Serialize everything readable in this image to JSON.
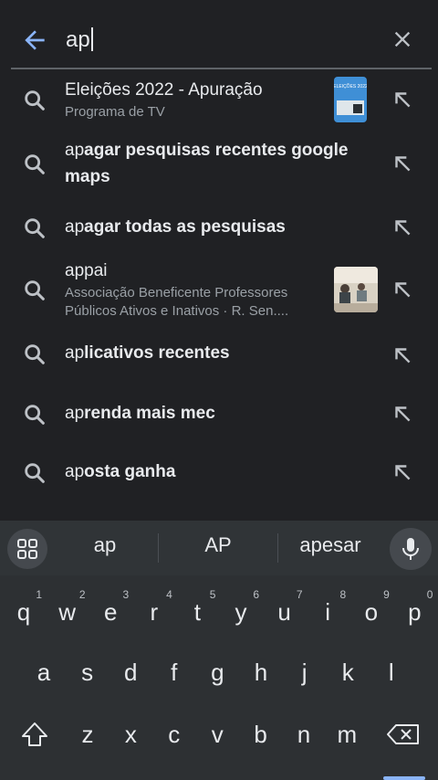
{
  "search": {
    "query": "ap"
  },
  "suggestions": [
    {
      "prefix": "",
      "rest": "Eleições 2022 - Apuração",
      "subtitle": "Programa de TV",
      "thumbnail": "eleicoes-2022-thumbnail",
      "thumb_text": "ELEIÇÕES 2022"
    },
    {
      "prefix": "ap",
      "rest": "agar pesquisas recentes google maps"
    },
    {
      "prefix": "ap",
      "rest": "agar todas as pesquisas"
    },
    {
      "prefix": "",
      "rest": "appai",
      "subtitle": "Associação Beneficente Professores Públicos Ativos e Inativos · R. Sen....",
      "thumbnail": "appai-photo-thumbnail"
    },
    {
      "prefix": "ap",
      "rest": "licativos recentes"
    },
    {
      "prefix": "ap",
      "rest": "renda mais mec"
    },
    {
      "prefix": "ap",
      "rest": "osta ganha"
    }
  ],
  "keyboard": {
    "suggestions": [
      "ap",
      "AP",
      "apesar"
    ],
    "row1": [
      {
        "key": "q",
        "num": "1"
      },
      {
        "key": "w",
        "num": "2"
      },
      {
        "key": "e",
        "num": "3"
      },
      {
        "key": "r",
        "num": "4"
      },
      {
        "key": "t",
        "num": "5"
      },
      {
        "key": "y",
        "num": "6"
      },
      {
        "key": "u",
        "num": "7"
      },
      {
        "key": "i",
        "num": "8"
      },
      {
        "key": "o",
        "num": "9"
      },
      {
        "key": "p",
        "num": "0"
      }
    ],
    "row2": [
      "a",
      "s",
      "d",
      "f",
      "g",
      "h",
      "j",
      "k",
      "l"
    ],
    "row3": [
      "z",
      "x",
      "c",
      "v",
      "b",
      "n",
      "m"
    ]
  },
  "colors": {
    "background": "#202124",
    "accent": "#8ab4f8",
    "text": "#e8eaed",
    "secondary_text": "#9aa0a6"
  }
}
